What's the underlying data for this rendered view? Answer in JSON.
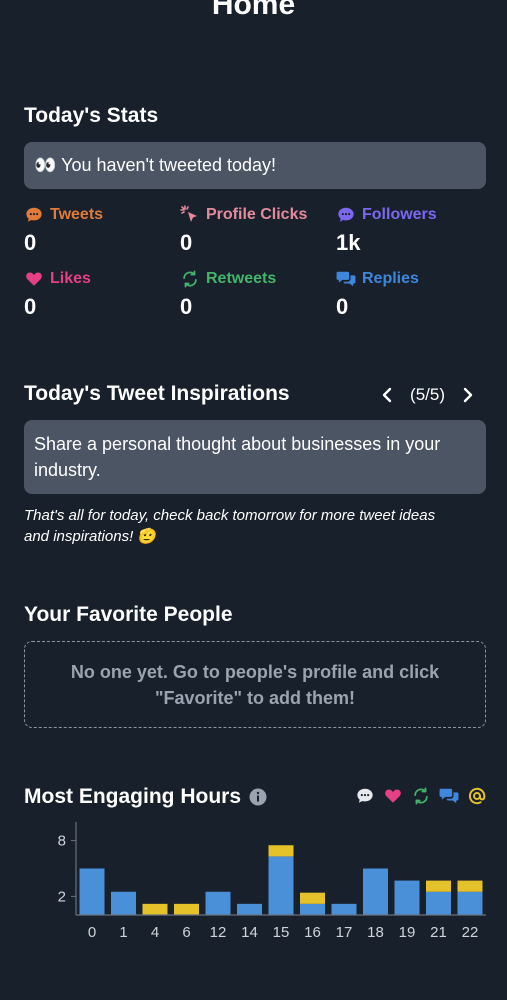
{
  "header": {
    "title": "Home"
  },
  "stats": {
    "title": "Today's Stats",
    "banner": "👀 You haven't tweeted today!",
    "items": [
      {
        "label": "Tweets",
        "value": "0",
        "icon": "chat-bubble-icon",
        "color": "#e07b39"
      },
      {
        "label": "Profile Clicks",
        "value": "0",
        "icon": "cursor-click-icon",
        "color": "#e58a9b"
      },
      {
        "label": "Followers",
        "value": "1k",
        "icon": "chat-dots-icon",
        "color": "#7c67f0"
      },
      {
        "label": "Likes",
        "value": "0",
        "icon": "heart-icon",
        "color": "#e53f86"
      },
      {
        "label": "Retweets",
        "value": "0",
        "icon": "retweet-icon",
        "color": "#44b36c"
      },
      {
        "label": "Replies",
        "value": "0",
        "icon": "replies-icon",
        "color": "#3f86dd"
      }
    ]
  },
  "inspirations": {
    "title": "Today's Tweet Inspirations",
    "pager": "(5/5)",
    "text": "Share a personal thought about businesses in your industry.",
    "note": "That's all for today, check back tomorrow for more tweet ideas and inspirations! 🫡"
  },
  "favorites": {
    "title": "Your Favorite People",
    "empty": "No one yet. Go to people's profile and click \"Favorite\" to add them!"
  },
  "engaging": {
    "title": "Most Engaging Hours",
    "legend_icons": [
      "comment-icon",
      "heart-icon",
      "retweet-icon",
      "replies-icon",
      "mention-icon"
    ],
    "colors": {
      "blue": "#4a90d9",
      "yellow": "#e5c22a"
    }
  },
  "chart_data": {
    "type": "bar",
    "categories": [
      "0",
      "1",
      "4",
      "6",
      "12",
      "14",
      "15",
      "16",
      "17",
      "18",
      "19",
      "21",
      "22"
    ],
    "series": [
      {
        "values": [
          5,
          2.5,
          0,
          0,
          2.5,
          1.2,
          6.3,
          1.2,
          1.2,
          5,
          3.7,
          2.5,
          2.5
        ]
      },
      {
        "values": [
          0,
          0,
          1.2,
          1.2,
          0,
          0,
          1.2,
          1.2,
          0,
          0,
          0,
          1.2,
          1.2
        ]
      }
    ],
    "yticks": [
      "2",
      "8"
    ],
    "ylim": [
      0,
      10
    ]
  }
}
